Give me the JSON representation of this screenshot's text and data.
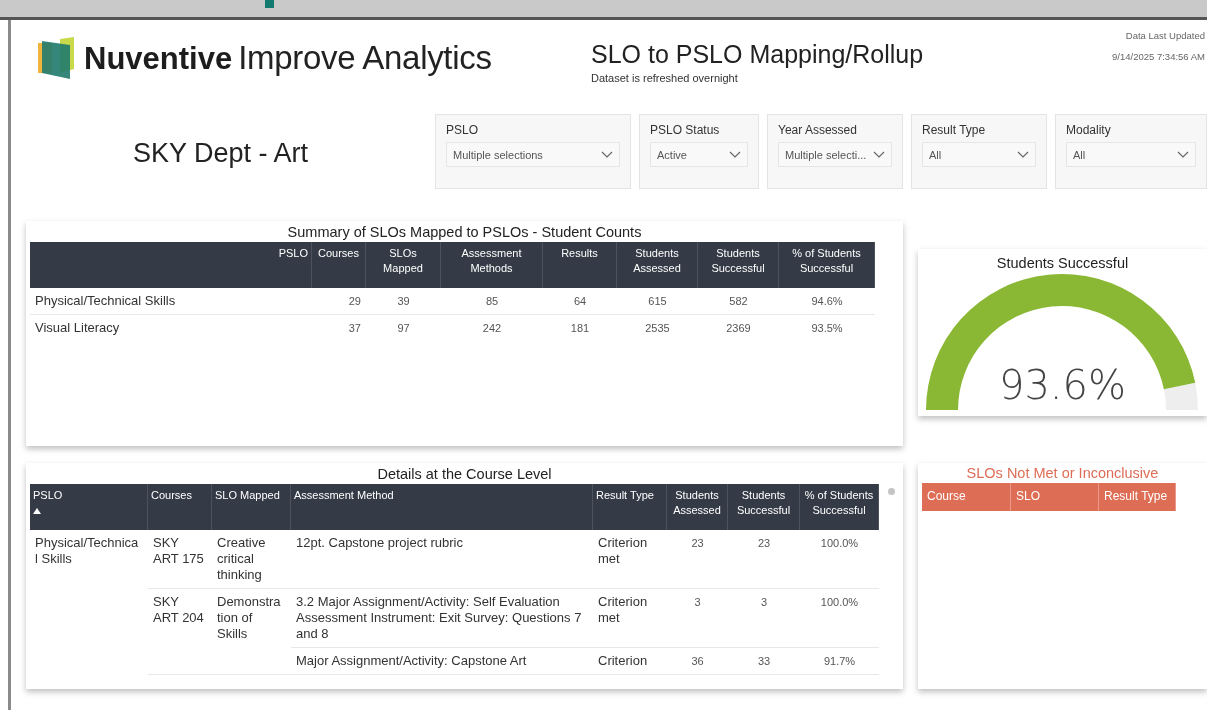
{
  "header": {
    "brand_bold": "Nuventive",
    "brand_light": "Improve Analytics",
    "title": "SLO to PSLO Mapping/Rollup",
    "subtitle": "Dataset is refreshed overnight",
    "updated_label": "Data Last Updated",
    "updated_value": "9/14/2025 7:34:56 AM"
  },
  "department": "SKY Dept - Art",
  "filters": [
    {
      "label": "PSLO",
      "value": "Multiple selections"
    },
    {
      "label": "PSLO Status",
      "value": "Active"
    },
    {
      "label": "Year Assessed",
      "value": "Multiple selecti..."
    },
    {
      "label": "Result Type",
      "value": "All"
    },
    {
      "label": "Modality",
      "value": "All"
    }
  ],
  "summary": {
    "title": "Summary of SLOs Mapped to PSLOs - Student Counts",
    "columns": [
      "PSLO",
      "Courses",
      "SLOs Mapped",
      "Assessment Methods",
      "Results",
      "Students Assessed",
      "Students Successful",
      "% of Students Successful"
    ],
    "rows": [
      [
        "Physical/Technical Skills",
        "29",
        "39",
        "85",
        "64",
        "615",
        "582",
        "94.6%"
      ],
      [
        "Visual Literacy",
        "37",
        "97",
        "242",
        "181",
        "2535",
        "2369",
        "93.5%"
      ]
    ]
  },
  "gauge": {
    "title": "Students Successful",
    "reading": "93.6%"
  },
  "details": {
    "title": "Details at the Course Level",
    "columns": [
      "PSLO",
      "Courses",
      "SLO Mapped",
      "Assessment Method",
      "Result Type",
      "Students Assessed",
      "Students Successful",
      "% of Students Successful"
    ],
    "groups": [
      {
        "pslo": "Physical/Technica l Skills",
        "courses": [
          {
            "course": "SKY ART 175",
            "slo": "Creative critical thinking",
            "methods": [
              {
                "method": "12pt. Capstone project rubric",
                "result_type": "Criterion met",
                "assessed": "23",
                "successful": "23",
                "percent": "100.0%"
              }
            ]
          },
          {
            "course": "SKY ART 204",
            "slo": "Demonstra tion of Skills",
            "methods": [
              {
                "method": "3.2 Major Assignment/Activity: Self Evaluation Assessment Instrument: Exit Survey: Questions 7 and 8",
                "result_type": "Criterion met",
                "assessed": "3",
                "successful": "3",
                "percent": "100.0%"
              },
              {
                "method": "Major Assignment/Activity: Capstone Art",
                "result_type": "Criterion",
                "assessed": "36",
                "successful": "33",
                "percent": "91.7%"
              }
            ]
          }
        ]
      }
    ]
  },
  "not_met": {
    "title": "SLOs Not Met or Inconclusive",
    "columns": [
      "Course",
      "SLO",
      "Result Type"
    ]
  }
}
